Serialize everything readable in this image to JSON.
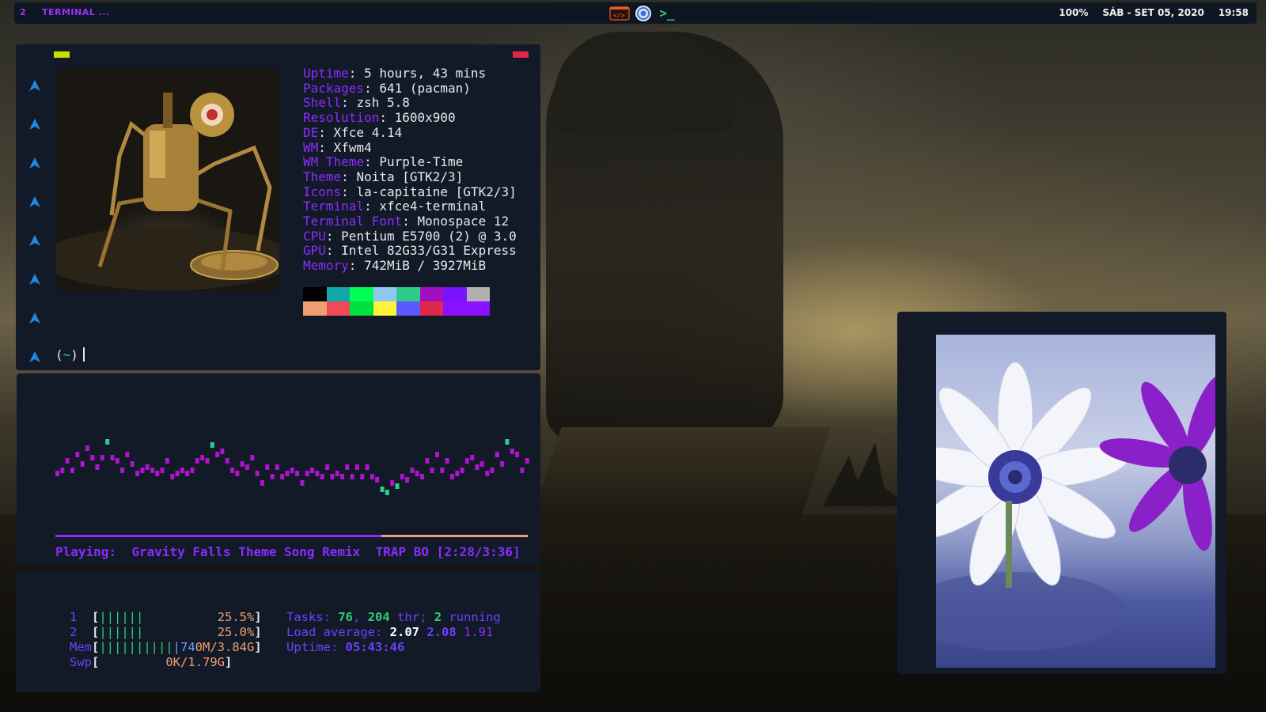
{
  "panel": {
    "workspace": "2",
    "window_title": "TERMINAL ...",
    "tray_icons": [
      "code-editor-icon",
      "chromium-icon",
      "terminal-icon"
    ],
    "terminal_icon_glyph": ">_",
    "battery": "100%",
    "date": "SÁB - SET 05, 2020",
    "time": "19:58"
  },
  "neofetch": {
    "gutter_icon": "arch-logo-icon",
    "gutter_count": 8,
    "info": [
      {
        "key": "Uptime",
        "value": "5 hours, 43 mins"
      },
      {
        "key": "Packages",
        "value": "641 (pacman)"
      },
      {
        "key": "Shell",
        "value": "zsh 5.8"
      },
      {
        "key": "Resolution",
        "value": "1600x900"
      },
      {
        "key": "DE",
        "value": "Xfce 4.14"
      },
      {
        "key": "WM",
        "value": "Xfwm4"
      },
      {
        "key": "WM Theme",
        "value": "Purple-Time"
      },
      {
        "key": "Theme",
        "value": "Noita [GTK2/3]"
      },
      {
        "key": "Icons",
        "value": "la-capitaine [GTK2/3]"
      },
      {
        "key": "Terminal",
        "value": "xfce4-terminal"
      },
      {
        "key": "Terminal Font",
        "value": "Monospace 12"
      },
      {
        "key": "CPU",
        "value": "Pentium E5700 (2) @ 3.0"
      },
      {
        "key": "GPU",
        "value": "Intel 82G33/G31 Express"
      },
      {
        "key": "Memory",
        "value": "742MiB / 3927MiB"
      }
    ],
    "palette": [
      "#000000",
      "#13a8a8",
      "#00ff55",
      "#8ec8f0",
      "#2ecc8a",
      "#a010c0",
      "#7a12ff",
      "#b0b0b0",
      "#f0a070",
      "#f04a5a",
      "#00e040",
      "#fff33a",
      "#5a5aff",
      "#e0284a",
      "#8a10ff",
      "#8a10ff"
    ],
    "prompt_open": "(",
    "prompt_tilde": "~",
    "prompt_close": ")"
  },
  "player": {
    "progress": 0.69,
    "playing_label": "Playing:",
    "track": "Gravity Falls Theme Song Remix",
    "extra": "TRAP BO",
    "time": "[2:28/3:36]",
    "cava_levels": [
      3,
      4,
      5,
      4,
      6,
      5,
      7,
      6,
      4,
      6,
      8,
      6,
      5,
      4,
      6,
      5,
      3,
      4,
      4,
      4,
      3,
      4,
      5,
      3,
      3,
      4,
      3,
      4,
      5,
      6,
      5,
      8,
      6,
      7,
      5,
      4,
      3,
      5,
      4,
      6,
      3,
      2,
      4,
      3,
      4,
      3,
      3,
      4,
      3,
      2,
      3,
      4,
      3,
      3,
      4,
      3,
      3,
      3,
      4,
      3,
      4,
      3,
      4,
      3,
      2,
      1,
      0,
      2,
      1,
      3,
      2,
      4,
      3,
      3,
      5,
      4,
      6,
      4,
      5,
      3,
      3,
      4,
      5,
      6,
      4,
      5,
      3,
      4,
      6,
      5,
      8,
      7,
      6,
      4,
      5
    ]
  },
  "htop": {
    "cpu1": {
      "label": "1",
      "bar": "||||||",
      "pct": "25.5%"
    },
    "cpu2": {
      "label": "2",
      "bar": "||||||",
      "pct": "25.0%"
    },
    "mem": {
      "label": "Mem",
      "bar": "||||||||||",
      "bar_blue": "|74",
      "value": "0M/3.84G"
    },
    "swp": {
      "label": "Swp",
      "value": "0K/1.79G"
    },
    "tasks_label": "Tasks:",
    "tasks": "76",
    "thr": "204",
    "thr_label": "thr;",
    "running": "2",
    "running_label": "running",
    "load_label": "Load average:",
    "load1": "2.07",
    "load5": "2.08",
    "load15": "1.91",
    "uptime_label": "Uptime:",
    "uptime": "05:43:46"
  },
  "viewer": {
    "image": "flower-photo"
  }
}
